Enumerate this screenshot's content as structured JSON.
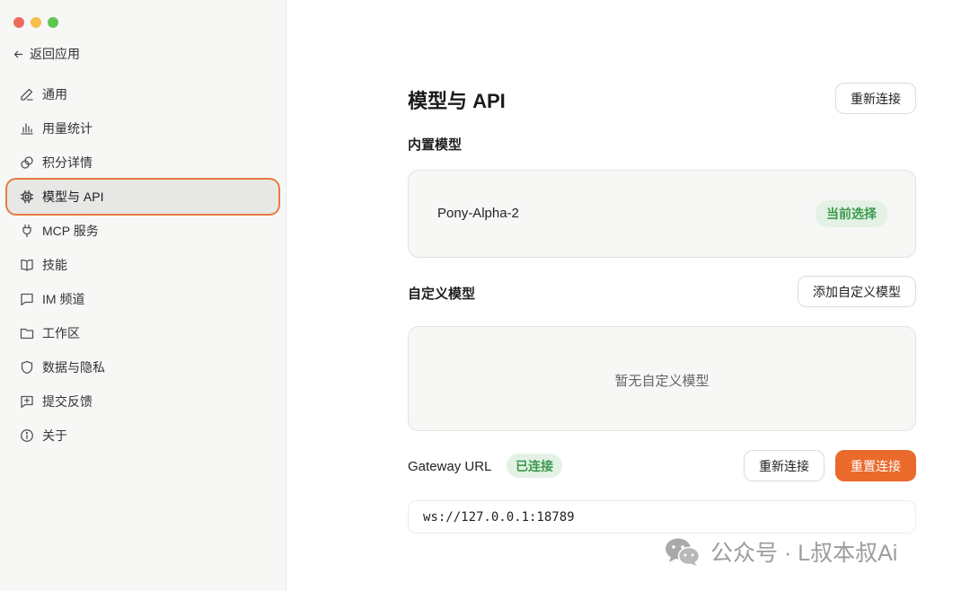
{
  "sidebar": {
    "back_label": "返回应用",
    "items": [
      {
        "label": "通用",
        "icon": "pencil-icon"
      },
      {
        "label": "用量统计",
        "icon": "bar-chart-icon"
      },
      {
        "label": "积分详情",
        "icon": "coins-icon"
      },
      {
        "label": "模型与 API",
        "icon": "chip-icon",
        "active": true
      },
      {
        "label": "MCP 服务",
        "icon": "plug-icon"
      },
      {
        "label": "技能",
        "icon": "book-icon"
      },
      {
        "label": "IM 频道",
        "icon": "chat-icon"
      },
      {
        "label": "工作区",
        "icon": "folder-icon"
      },
      {
        "label": "数据与隐私",
        "icon": "shield-icon"
      },
      {
        "label": "提交反馈",
        "icon": "feedback-icon"
      },
      {
        "label": "关于",
        "icon": "info-icon"
      }
    ]
  },
  "main": {
    "title": "模型与 API",
    "reconnect_label": "重新连接",
    "builtin": {
      "label": "内置模型",
      "model_name": "Pony-Alpha-2",
      "badge": "当前选择"
    },
    "custom": {
      "label": "自定义模型",
      "add_label": "添加自定义模型",
      "empty_text": "暂无自定义模型"
    },
    "gateway": {
      "label": "Gateway URL",
      "status": "已连接",
      "reconnect_label": "重新连接",
      "reset_label": "重置连接",
      "url": "ws://127.0.0.1:18789"
    }
  },
  "watermark": {
    "text": "公众号 · L叔本叔Ai",
    "icon": "wechat-icon"
  },
  "colors": {
    "accent": "#ea6a2c",
    "success_bg": "#e4f2e6",
    "success_text": "#3c9a4c"
  }
}
